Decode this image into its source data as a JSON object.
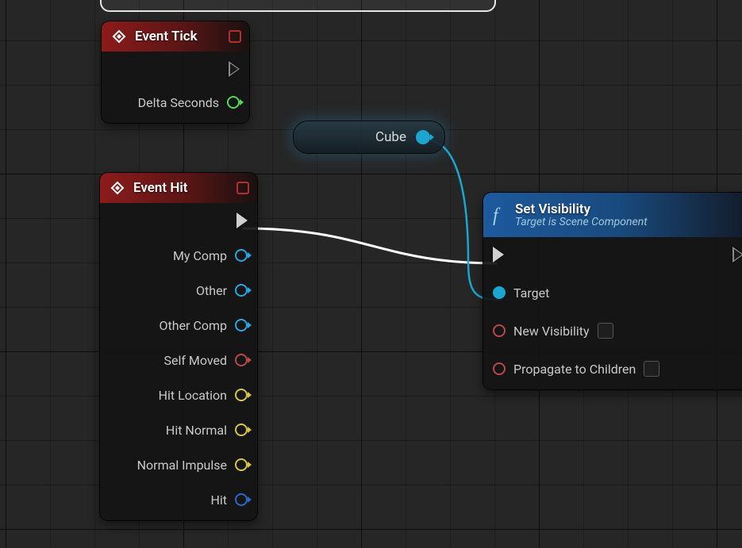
{
  "nodes": {
    "event_tick": {
      "title": "Event Tick",
      "outputs": {
        "delta_seconds": "Delta Seconds"
      }
    },
    "event_hit": {
      "title": "Event Hit",
      "outputs": {
        "my_comp": "My Comp",
        "other": "Other",
        "other_comp": "Other Comp",
        "self_moved": "Self Moved",
        "hit_location": "Hit Location",
        "hit_normal": "Hit Normal",
        "normal_impulse": "Normal Impulse",
        "hit": "Hit"
      }
    },
    "cube_var": {
      "label": "Cube"
    },
    "set_visibility": {
      "title": "Set Visibility",
      "subtitle": "Target is Scene Component",
      "inputs": {
        "target": "Target",
        "new_visibility": "New Visibility",
        "propagate": "Propagate to Children"
      }
    }
  }
}
